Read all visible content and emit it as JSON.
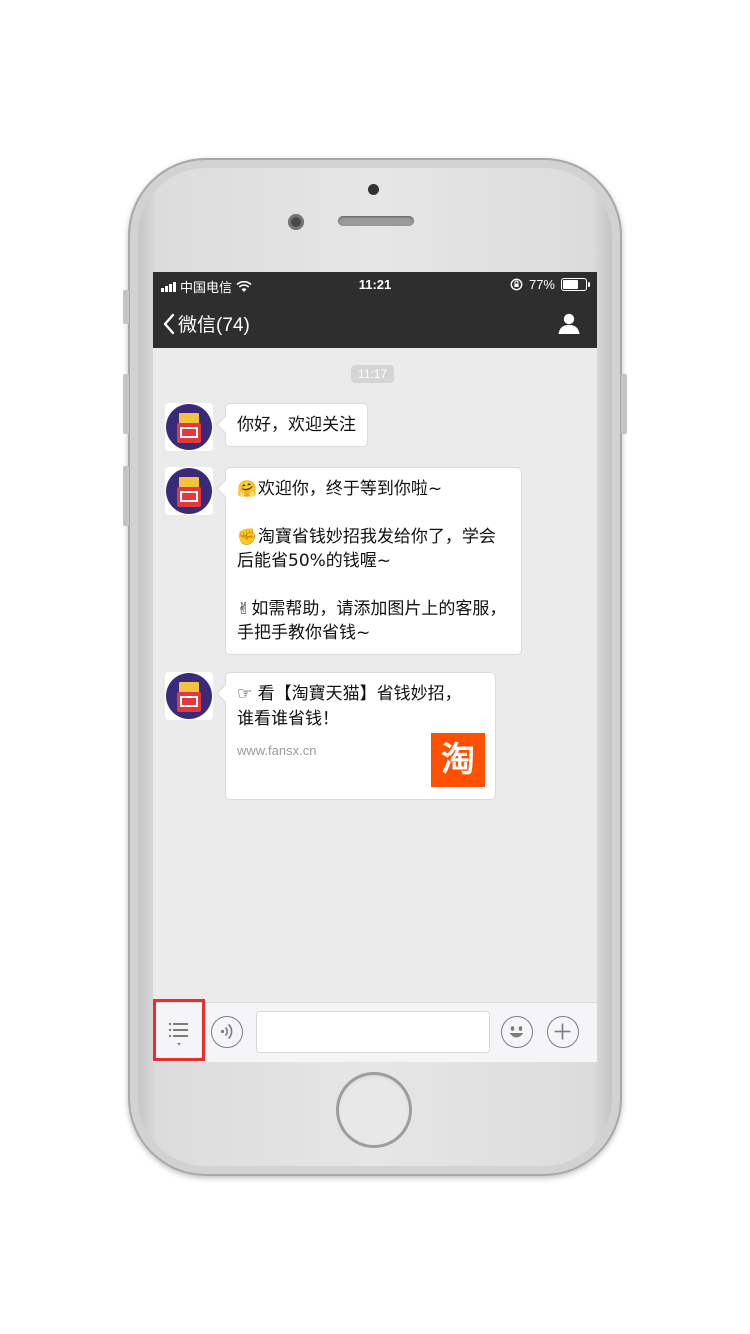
{
  "status_bar": {
    "carrier": "中国电信",
    "time": "11:21",
    "battery": "77%",
    "battery_level": 0.77
  },
  "nav": {
    "back_label": "微信(74)",
    "back_icon": "chevron-left-icon",
    "profile_icon": "person-icon"
  },
  "chat": {
    "timestamp": "11:17",
    "messages": [
      {
        "text": "你好，欢迎关注"
      },
      {
        "paragraphs": [
          {
            "emoji": "🤗",
            "text": "欢迎你，终于等到你啦~"
          },
          {
            "emoji": "✊",
            "text": "淘寶省钱妙招我发给你了，学会后能省50%的钱喔~"
          },
          {
            "emoji": "✌",
            "text": "如需帮助，请添加图片上的客服，手把手教你省钱~"
          }
        ]
      },
      {
        "link_title": "☞ 看【淘寶天猫】省钱妙招，谁看谁省钱！",
        "link_source": "www.fansx.cn",
        "thumb_text": "淘"
      }
    ]
  },
  "avatar_icon": "taobao-avatar-icon",
  "colors": {
    "nav_bg": "#2e2e2e",
    "chat_bg": "#ebebeb",
    "highlight_box": "#e53030",
    "thumb_bg": "#ff5000"
  }
}
